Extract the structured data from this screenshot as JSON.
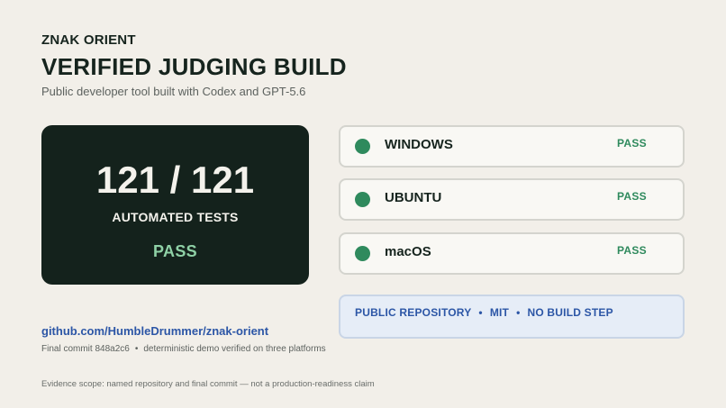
{
  "header": {
    "brand": "ZNAK ORIENT",
    "title": "VERIFIED JUDGING BUILD",
    "subtitle": "Public developer tool built with Codex and GPT-5.6"
  },
  "score_card": {
    "score": "121 / 121",
    "label": "AUTOMATED TESTS",
    "status": "PASS"
  },
  "platforms": [
    {
      "name": "WINDOWS",
      "status": "PASS",
      "status_color": "#2f8a5d"
    },
    {
      "name": "UBUNTU",
      "status": "PASS",
      "status_color": "#2f8a5d"
    },
    {
      "name": "macOS",
      "status": "PASS",
      "status_color": "#2f8a5d"
    }
  ],
  "repo_info": {
    "chips": [
      "PUBLIC REPOSITORY",
      "MIT",
      "NO BUILD STEP"
    ],
    "separator": "•"
  },
  "repository": {
    "link_text": "github.com/HumbleDrummer/znak-orient",
    "commit": "Final commit 848a2c6",
    "separator": "•",
    "commit_note": "deterministic demo verified on three platforms"
  },
  "footer": {
    "scope": "Evidence scope: named repository and final commit — not a production-readiness claim"
  },
  "colors": {
    "background": "#f2efe9",
    "card_dark": "#14221c",
    "pass_green": "#2f8a5d",
    "pass_light": "#8fd1a6",
    "link_blue": "#2c56a6"
  }
}
